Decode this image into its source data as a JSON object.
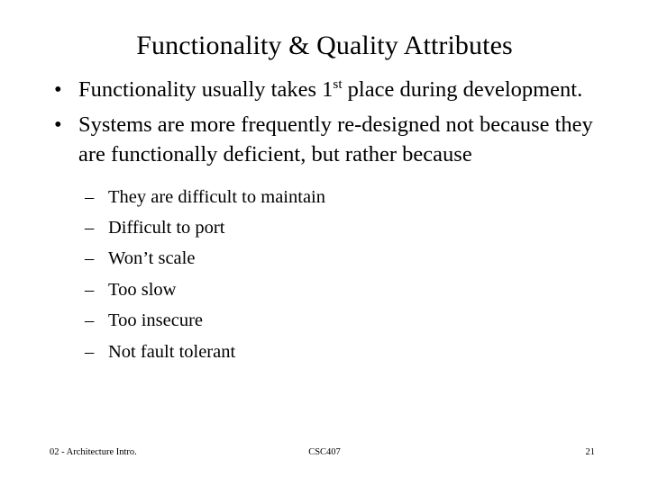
{
  "slide": {
    "title": "Functionality & Quality Attributes",
    "bullets": [
      {
        "marker": "•",
        "text_before": "Functionality usually takes 1",
        "superscript": "st",
        "text_after": " place during development."
      },
      {
        "marker": "•",
        "text": "Systems are more frequently re-designed not because they are functionally deficient, but rather because"
      }
    ],
    "sub_bullets": [
      {
        "marker": "–",
        "text": "They are difficult to maintain"
      },
      {
        "marker": "–",
        "text": "Difficult to port"
      },
      {
        "marker": "–",
        "text": "Won’t scale"
      },
      {
        "marker": "–",
        "text": "Too slow"
      },
      {
        "marker": "–",
        "text": "Too insecure"
      },
      {
        "marker": "–",
        "text": "Not fault tolerant"
      }
    ],
    "footer": {
      "left": "02 - Architecture Intro.",
      "center": "CSC407",
      "right": "21"
    },
    "colors": {
      "background": "#ffffff",
      "text": "#000000"
    }
  }
}
